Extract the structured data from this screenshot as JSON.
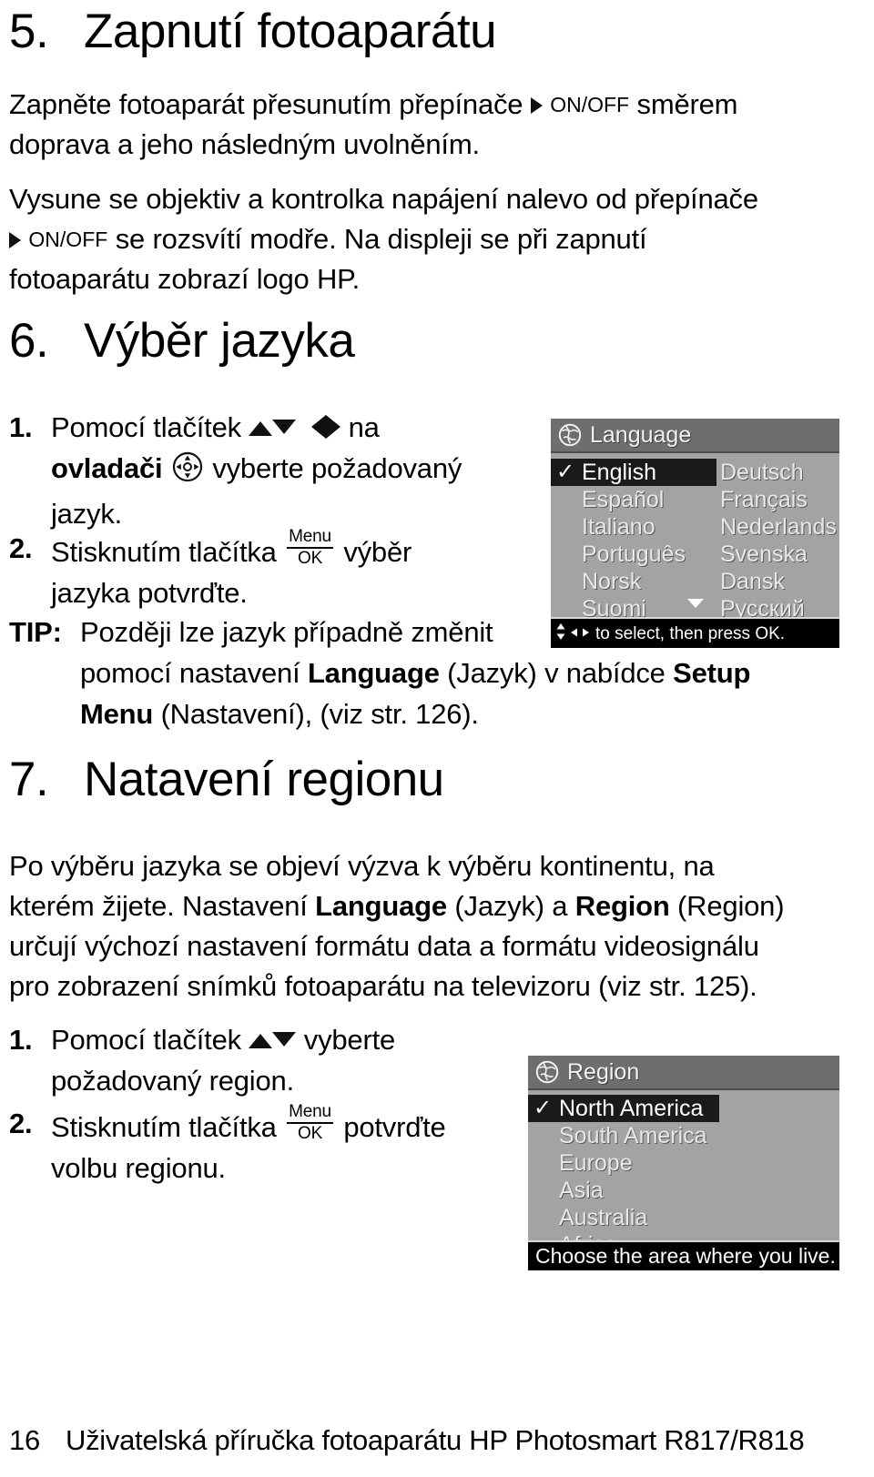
{
  "document": {
    "language": "cs",
    "page_number": "16",
    "footer_text": "Uživatelská příručka fotoaparátu HP Photosmart R817/R818"
  },
  "sections": [
    {
      "number": "5.",
      "title": "Zapnutí fotoaparátu",
      "paragraphs": [
        {
          "id": "p1",
          "lines": [
            "Zapněte fotoaparát přesunutím přepínače",
            "ON/OFF",
            "směrem",
            "doprava a jeho následným uvolněním."
          ],
          "text_full": "Zapněte fotoaparát přesunutím přepínače ▶ON/OFF směrem doprava a jeho následným uvolněním."
        },
        {
          "id": "p2",
          "lines": [
            "Vysune se objektiv a kontrolka napájení nalevo od přepínače",
            "ON/OFF",
            "se rozsvítí modře. Na displeji se při zapnutí",
            "fotoaparátu zobrazí logo HP."
          ],
          "text_full": "Vysune se objektiv a kontrolka napájení nalevo od přepínače ▶ON/OFF se rozsvítí modře. Na displeji se při zapnutí fotoaparátu zobrazí logo HP."
        }
      ]
    },
    {
      "number": "6.",
      "title": "Výběr jazyka",
      "steps": [
        {
          "marker": "1.",
          "seg_a": "Pomocí tlačítek",
          "seg_b": "na",
          "seg_c": "ovladači",
          "seg_d": "vyberte požadovaný",
          "seg_e": "jazyk."
        },
        {
          "marker": "2.",
          "seg_a": "Stisknutím tlačítka",
          "seg_b": "výběr",
          "seg_c": "jazyka potvrďte."
        }
      ],
      "tip": {
        "marker": "TIP:",
        "line1": "Později lze jazyk případně změnit",
        "line2_a": "pomocí nastavení",
        "line2_b": "Language",
        "line2_c": "(Jazyk) v nabídce",
        "line2_d": "Setup",
        "line3_a": "Menu",
        "line3_b": "(Nastavení), (viz str. 126)."
      }
    },
    {
      "number": "7.",
      "title": "Natavení regionu",
      "paragraph": {
        "line1": "Po výběru jazyka se objeví výzva k výběru kontinentu, na",
        "line2_a": "kterém žijete. Nastavení",
        "line2_b": "Language",
        "line2_c": "(Jazyk) a",
        "line2_d": "Region",
        "line2_e": "(Region)",
        "line3": "určují výchozí nastavení formátu data a formátu videosignálu",
        "line4": "pro zobrazení snímků fotoaparátu na televizoru (viz str. 125)."
      },
      "steps": [
        {
          "marker": "1.",
          "seg_a": "Pomocí tlačítek",
          "seg_b": "vyberte",
          "seg_c": "požadovaný region."
        },
        {
          "marker": "2.",
          "seg_a": "Stisknutím tlačítka",
          "seg_b": "potvrďte",
          "seg_c": "volbu regionu."
        }
      ]
    }
  ],
  "lcd_language_menu": {
    "title": "Language",
    "title_icon": "globe-icon",
    "columns": [
      {
        "items": [
          {
            "label": "English",
            "selected": true,
            "checked": true
          },
          {
            "label": "Español",
            "selected": false,
            "checked": false
          },
          {
            "label": "Italiano",
            "selected": false,
            "checked": false
          },
          {
            "label": "Português",
            "selected": false,
            "checked": false
          },
          {
            "label": "Norsk",
            "selected": false,
            "checked": false
          },
          {
            "label": "Suomi",
            "selected": false,
            "checked": false
          }
        ]
      },
      {
        "items": [
          {
            "label": "Deutsch",
            "selected": false,
            "checked": false
          },
          {
            "label": "Français",
            "selected": false,
            "checked": false
          },
          {
            "label": "Nederlands",
            "selected": false,
            "checked": false
          },
          {
            "label": "Svenska",
            "selected": false,
            "checked": false
          },
          {
            "label": "Dansk",
            "selected": false,
            "checked": false
          },
          {
            "label": "Русский",
            "selected": false,
            "checked": false
          }
        ]
      }
    ],
    "has_more_indicator": true,
    "status_text": "to select, then press OK.",
    "status_icons": [
      "updown-arrow-icon",
      "leftright-arrow-icon"
    ],
    "colors": {
      "background": "#a3a3a3",
      "titlebar": "#6e6e6e",
      "selected_row": "#1a1a1a",
      "statusbar": "#000000",
      "text": "#e8e8e8"
    }
  },
  "lcd_region_menu": {
    "title": "Region",
    "title_icon": "globe-icon",
    "items": [
      {
        "label": "North America",
        "selected": true,
        "checked": true
      },
      {
        "label": "South America",
        "selected": false,
        "checked": false
      },
      {
        "label": "Europe",
        "selected": false,
        "checked": false
      },
      {
        "label": "Asia",
        "selected": false,
        "checked": false
      },
      {
        "label": "Australia",
        "selected": false,
        "checked": false
      },
      {
        "label": "Africa",
        "selected": false,
        "checked": false
      }
    ],
    "status_text": "Choose the area where you live.",
    "colors": {
      "background": "#a3a3a3",
      "titlebar": "#6e6e6e",
      "selected_row": "#1a1a1a",
      "statusbar": "#000000",
      "text": "#e8e8e8"
    }
  },
  "glyphs": {
    "checkmark": "✓",
    "switch_arrow": "▶",
    "onoff_label": "ON/OFF",
    "menu_label": "Menu",
    "ok_label": "OK"
  }
}
